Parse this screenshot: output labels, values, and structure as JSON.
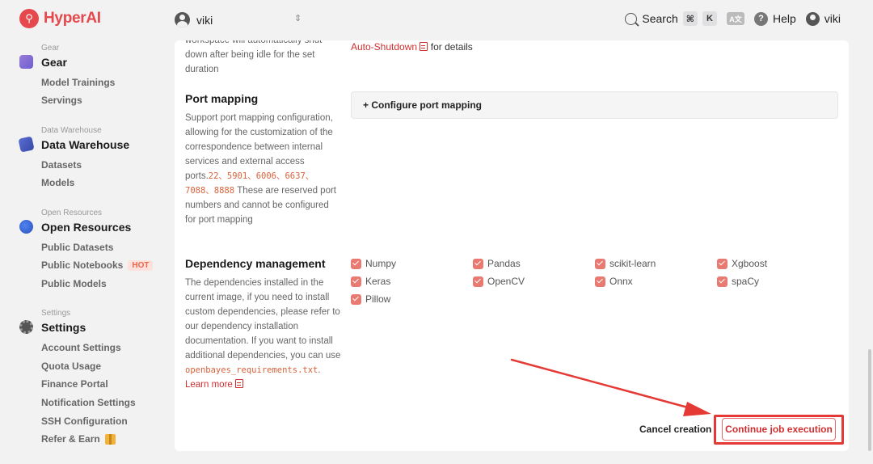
{
  "app": {
    "logo_text": "HyperAI",
    "logo_glyph": "⚲"
  },
  "workspace": {
    "name": "viki",
    "caret": "⇕"
  },
  "topbar": {
    "search_label": "Search",
    "shortcut_mod": "⌘",
    "shortcut_key": "K",
    "translate_glyph": "A文",
    "help_label": "Help",
    "help_glyph": "?",
    "user_name": "viki"
  },
  "sidebar": {
    "gear": {
      "small": "Gear",
      "title": "Gear",
      "items": [
        "Model Trainings",
        "Servings"
      ]
    },
    "data_warehouse": {
      "small": "Data Warehouse",
      "title": "Data Warehouse",
      "items": [
        "Datasets",
        "Models"
      ]
    },
    "open_resources": {
      "small": "Open Resources",
      "title": "Open Resources",
      "items": [
        "Public Datasets",
        "Public Notebooks",
        "Public Models"
      ],
      "hot_badge": "HOT"
    },
    "settings": {
      "small": "Settings",
      "title": "Settings",
      "items": [
        "Account Settings",
        "Quota Usage",
        "Finance Portal",
        "Notification Settings",
        "SSH Configuration",
        "Refer & Earn"
      ]
    }
  },
  "main": {
    "shutdown_desc_partial": "workspace will automatically shut down after being idle for the set duration",
    "shutdown_link": "Auto-Shutdown",
    "shutdown_suffix": "for details",
    "port": {
      "label": "Port mapping",
      "desc_pre": "Support port mapping configuration, allowing for the customization of the correspondence between internal services and external access ports.",
      "desc_ports": "22、5901、6006、6637、7088、8888",
      "desc_post": " These are reserved port numbers and cannot be configured for port mapping",
      "button": "+ Configure port mapping"
    },
    "deps": {
      "label": "Dependency management",
      "desc_pre": "The dependencies installed in the current image, if you need to install custom dependencies, please refer to our dependency installation documentation. If you want to install additional dependencies, you can use",
      "desc_file": "openbayes_requirements.txt",
      "desc_dot": ".",
      "learn_more": "Learn more",
      "items": [
        "Numpy",
        "Pandas",
        "scikit-learn",
        "Xgboost",
        "Keras",
        "OpenCV",
        "Onnx",
        "spaCy",
        "Pillow"
      ]
    },
    "actions": {
      "cancel": "Cancel creation",
      "continue": "Continue job execution"
    }
  },
  "colors": {
    "brand": "#e5484d",
    "link": "#d12f2f",
    "checkbox": "#e87a72",
    "annotation": "#e53935"
  }
}
